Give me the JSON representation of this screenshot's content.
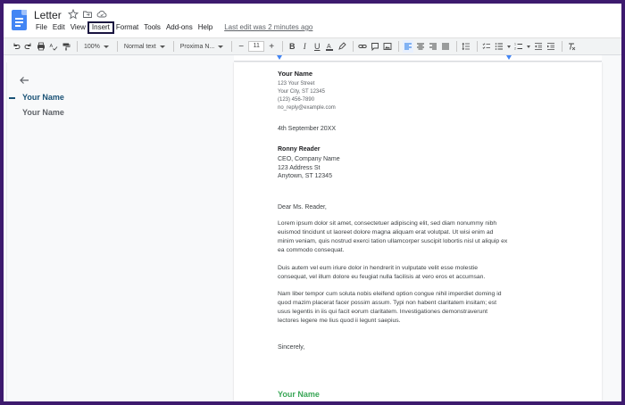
{
  "doc": {
    "title": "Letter",
    "menus": [
      "File",
      "Edit",
      "View",
      "Insert",
      "Format",
      "Tools",
      "Add-ons",
      "Help"
    ],
    "last_edit": "Last edit was 2 minutes ago"
  },
  "toolbar": {
    "zoom": "100%",
    "style": "Normal text",
    "font": "Proxima N...",
    "size": "11"
  },
  "outline": {
    "heading": "Your Name",
    "item": "Your Name"
  },
  "letter": {
    "sender_name": "Your Name",
    "sender_street": "123 Your Street",
    "sender_city": "Your City, ST 12345",
    "sender_phone": "(123) 456-7890",
    "sender_email": "no_reply@example.com",
    "date": "4th September 20XX",
    "recipient_name": "Ronny Reader",
    "recipient_title": "CEO, Company Name",
    "recipient_street": "123 Address St",
    "recipient_city": "Anytown, ST 12345",
    "salutation": "Dear Ms. Reader,",
    "para1": "Lorem ipsum dolor sit amet, consectetuer adipiscing elit, sed diam nonummy nibh euismod tincidunt ut laoreet dolore magna aliquam erat volutpat. Ut wisi enim ad minim veniam, quis nostrud exerci tation ullamcorper suscipit lobortis nisl ut aliquip ex ea commodo consequat.",
    "para2": "Duis autem vel eum iriure dolor in hendrerit in vulputate velit esse molestie consequat, vel illum dolore eu feugiat nulla facilisis at vero eros et accumsan.",
    "para3": "Nam liber tempor cum soluta nobis eleifend option congue nihil imperdiet doming id quod mazim placerat facer possim assum. Typi non habent claritatem insitam; est usus legentis in iis qui facit eorum claritatem. Investigationes demonstraverunt lectores legere me lius quod ii legunt saepius.",
    "closing": "Sincerely,",
    "signature": "Your Name"
  },
  "colors": {
    "accent": "#4285f4",
    "signature": "#3aa757",
    "outline_active": "#1a5276",
    "frame": "#3d1a6e"
  }
}
